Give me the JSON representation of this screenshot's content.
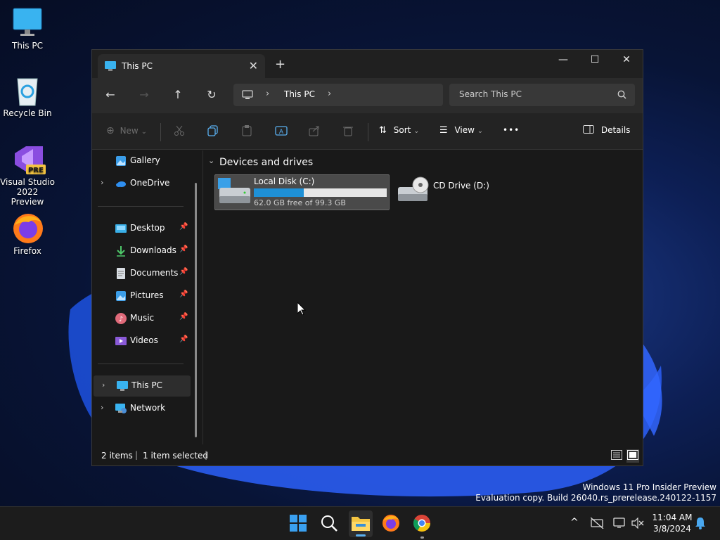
{
  "desktop": {
    "icons": [
      {
        "label": "This PC"
      },
      {
        "label": "Recycle Bin"
      },
      {
        "label": "Visual Studio 2022 Preview"
      },
      {
        "label": "Firefox"
      }
    ],
    "watermark_line1": "Windows 11 Pro Insider Preview",
    "watermark_line2": "Evaluation copy. Build 26040.rs_prerelease.240122-1157"
  },
  "window": {
    "tab_title": "This PC",
    "tab_close": "✕",
    "new_tab": "+",
    "minimize": "—",
    "maximize": "☐",
    "close": "✕"
  },
  "nav": {
    "back": "←",
    "forward": "→",
    "up": "↑",
    "refresh": "↻",
    "address_current": "This PC",
    "address_sep1": "›",
    "address_sep2": "›",
    "search_placeholder": "Search This PC"
  },
  "toolbar": {
    "new_label": "New",
    "new_plus": "⊕",
    "new_chevron": "⌄",
    "sort_label": "Sort",
    "sort_chevron": "⌄",
    "view_label": "View",
    "view_chevron": "⌄",
    "more": "•••",
    "details_label": "Details"
  },
  "sidebar": {
    "items": [
      {
        "label": "Gallery"
      },
      {
        "label": "OneDrive",
        "chevron": "›"
      },
      {
        "label": "Desktop",
        "pin": "📌"
      },
      {
        "label": "Downloads",
        "pin": "📌"
      },
      {
        "label": "Documents",
        "pin": "📌"
      },
      {
        "label": "Pictures",
        "pin": "📌"
      },
      {
        "label": "Music",
        "pin": "📌"
      },
      {
        "label": "Videos",
        "pin": "📌"
      },
      {
        "label": "This PC",
        "chevron": "›"
      },
      {
        "label": "Network",
        "chevron": "›"
      }
    ]
  },
  "content": {
    "group_title": "Devices and drives",
    "group_chevron": "⌄",
    "drives": [
      {
        "name": "Local Disk (C:)",
        "free_text": "62.0 GB free of 99.3 GB",
        "used_fraction": 0.376
      },
      {
        "name": "CD Drive (D:)"
      }
    ]
  },
  "status": {
    "items": "2 items",
    "selected": "1 item selected",
    "sep": "|"
  },
  "taskbar": {
    "time": "11:04 AM",
    "date": "3/8/2024",
    "tray_chevron": "^"
  },
  "colors": {
    "accent": "#1e90d6",
    "window_bg": "#191919",
    "selected": "#333333"
  }
}
